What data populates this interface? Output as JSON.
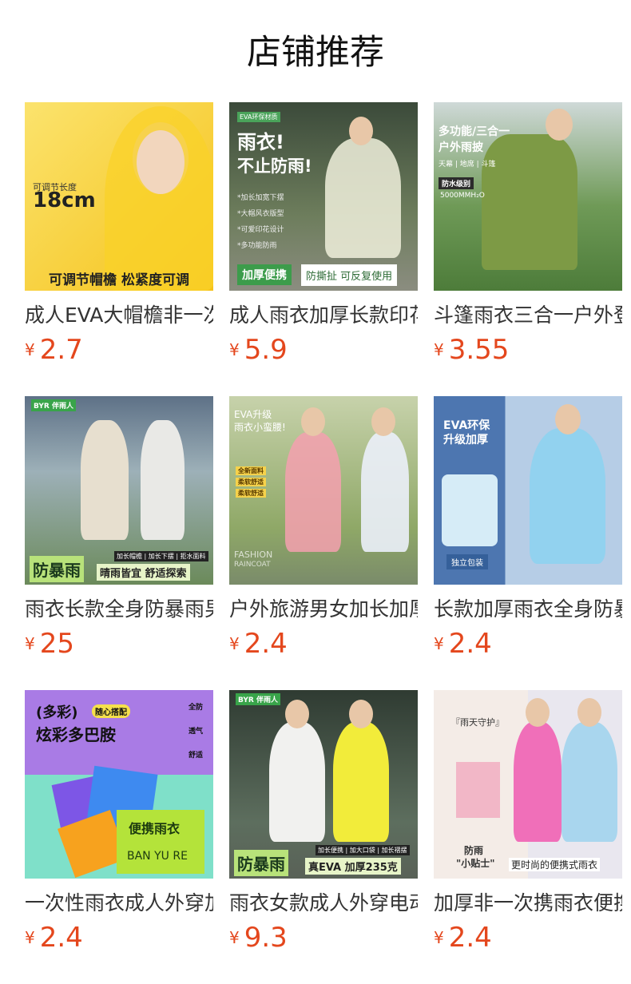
{
  "page": {
    "title": "店铺推荐"
  },
  "currency": "¥",
  "products": [
    {
      "name": "成人EVA大帽檐非一次",
      "price": "2.7",
      "thumb": {
        "texts": [
          "可调节长度",
          "18cm",
          "可调节帽檐 松紧度可调"
        ]
      }
    },
    {
      "name": "成人雨衣加厚长款印花",
      "price": "5.9",
      "thumb": {
        "texts": [
          "EVA环保材质",
          "雨衣!",
          "不止防雨!",
          "*加长加宽下摆",
          "*大帽风衣版型",
          "*可爱印花设计",
          "*多功能防雨",
          "加厚便携",
          "防撕扯 可反复使用"
        ]
      }
    },
    {
      "name": "斗篷雨衣三合一户外登",
      "price": "3.55",
      "thumb": {
        "texts": [
          "多功能/三合一",
          "户外雨披",
          "天幕 | 地席 | 斗篷",
          "防水级别",
          "5000MMH₂O"
        ]
      }
    },
    {
      "name": "雨衣长款全身防暴雨男",
      "price": "25",
      "thumb": {
        "texts": [
          "BYR 伴雨人",
          "加长帽檐 | 加长下摆 | 拒水面料",
          "防暴雨",
          "晴雨皆宜 舒适探索"
        ]
      }
    },
    {
      "name": "户外旅游男女加长加厚",
      "price": "2.4",
      "thumb": {
        "texts": [
          "EVA升级",
          "雨衣小蛮腰!",
          "全新面料",
          "柔软舒适",
          "柔软舒适",
          "FASHION",
          "RAINCOAT"
        ]
      }
    },
    {
      "name": "长款加厚雨衣全身防暴",
      "price": "2.4",
      "thumb": {
        "texts": [
          "EVA环保",
          "升级加厚",
          "独立包装"
        ]
      }
    },
    {
      "name": "一次性雨衣成人外穿加",
      "price": "2.4",
      "thumb": {
        "texts": [
          "(多彩)",
          "随心搭配",
          "炫彩多巴胺",
          "全防",
          "透气",
          "舒适",
          "便携雨衣",
          "BAN YU RE"
        ]
      }
    },
    {
      "name": "雨衣女款成人外穿电动",
      "price": "9.3",
      "thumb": {
        "texts": [
          "BYR 伴雨人",
          "加长便携 | 加大口袋 | 加长褶摆",
          "防暴雨",
          "真EVA 加厚235克"
        ]
      }
    },
    {
      "name": "加厚非一次携雨衣便携",
      "price": "2.4",
      "thumb": {
        "texts": [
          "『雨天守护』",
          "防雨",
          "\"小贴士\"",
          "更时尚的便携式雨衣"
        ]
      }
    }
  ],
  "colors": {
    "price": "#e4471d",
    "title": "#111111",
    "name": "#333333"
  }
}
